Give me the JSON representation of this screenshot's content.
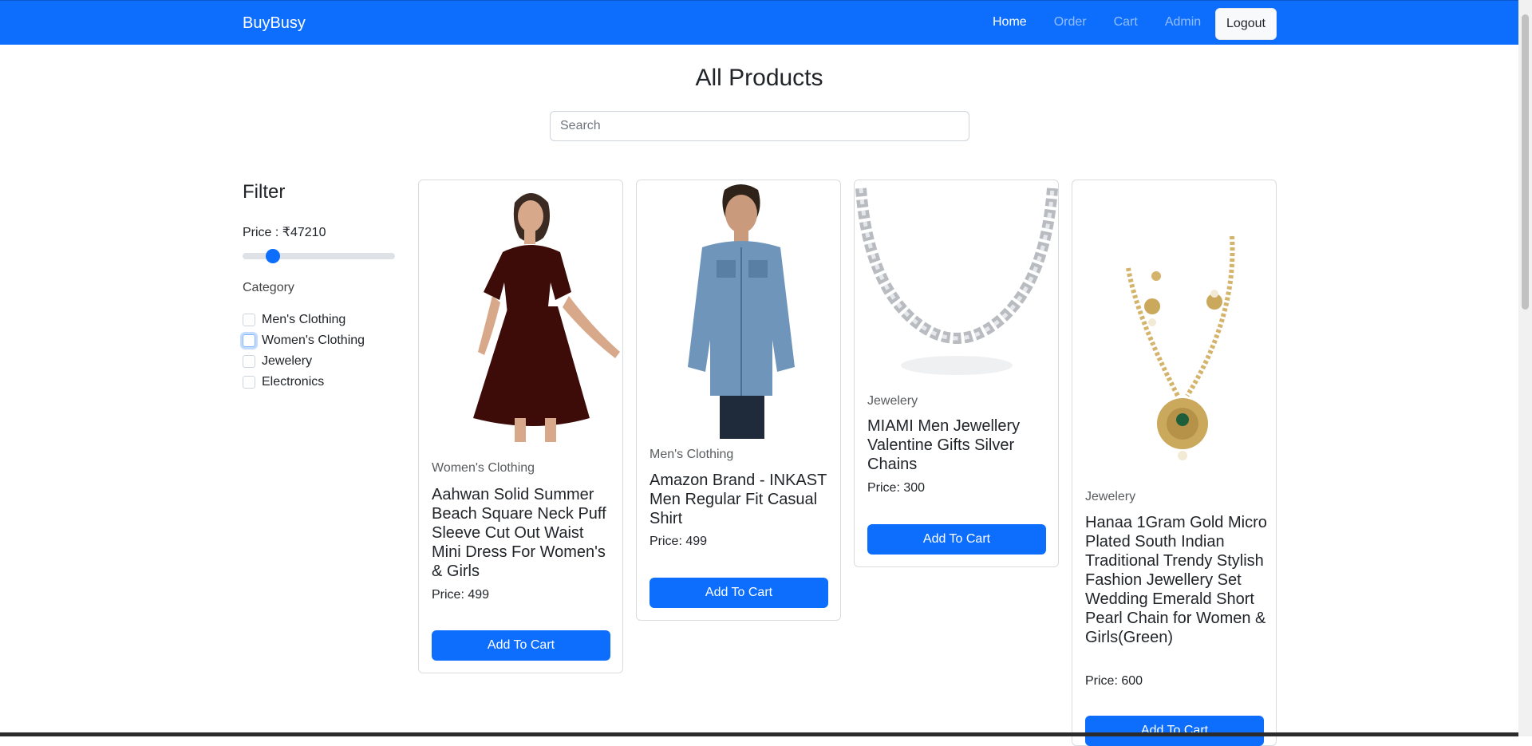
{
  "nav": {
    "brand": "BuyBusy",
    "links": [
      "Home",
      "Order",
      "Cart",
      "Admin"
    ],
    "logout": "Logout"
  },
  "page": {
    "title": "All Products",
    "search_placeholder": "Search"
  },
  "filter": {
    "title": "Filter",
    "price_label": "Price : ₹47210",
    "price_slider_fraction": 0.17,
    "category_label": "Category",
    "categories": [
      "Men's Clothing",
      "Women's Clothing",
      "Jewelery",
      "Electronics"
    ]
  },
  "products": [
    {
      "category": "Women's Clothing",
      "name": "Aahwan Solid Summer Beach Square Neck Puff Sleeve Cut Out Waist Mini Dress For Women's & Girls",
      "price": "Price: 499",
      "button": "Add To Cart"
    },
    {
      "category": "Men's Clothing",
      "name": "Amazon Brand - INKAST Men Regular Fit Casual Shirt",
      "price": "Price: 499",
      "button": "Add To Cart"
    },
    {
      "category": "Jewelery",
      "name": "MIAMI Men Jewellery Valentine Gifts Silver Chains",
      "price": "Price: 300",
      "button": "Add To Cart"
    },
    {
      "category": "Jewelery",
      "name": "Hanaa 1Gram Gold Micro Plated South Indian Traditional Trendy Stylish Fashion Jewellery Set Wedding Emerald Short Pearl Chain for Women & Girls(Green)",
      "price": "Price: 600",
      "button": "Add To Cart"
    }
  ],
  "colors": {
    "primary": "#0d6efd",
    "navbar": "#0d6efd"
  }
}
